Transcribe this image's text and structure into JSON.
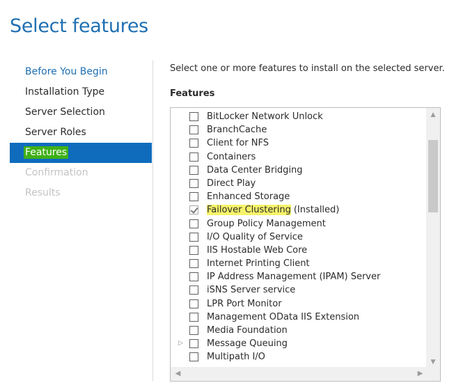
{
  "page": {
    "title": "Select features"
  },
  "nav": {
    "items": [
      {
        "label": "Before You Begin",
        "state": "link"
      },
      {
        "label": "Installation Type",
        "state": "normal"
      },
      {
        "label": "Server Selection",
        "state": "normal"
      },
      {
        "label": "Server Roles",
        "state": "normal"
      },
      {
        "label": "Features",
        "state": "selected"
      },
      {
        "label": "Confirmation",
        "state": "disabled"
      },
      {
        "label": "Results",
        "state": "disabled"
      }
    ]
  },
  "main": {
    "instruction": "Select one or more features to install on the selected server.",
    "features_heading": "Features",
    "features": [
      {
        "label": "BitLocker Network Unlock",
        "checked": false
      },
      {
        "label": "BranchCache",
        "checked": false
      },
      {
        "label": "Client for NFS",
        "checked": false
      },
      {
        "label": "Containers",
        "checked": false
      },
      {
        "label": "Data Center Bridging",
        "checked": false
      },
      {
        "label": "Direct Play",
        "checked": false
      },
      {
        "label": "Enhanced Storage",
        "checked": false
      },
      {
        "label": "Failover Clustering",
        "suffix": "(Installed)",
        "checked": true,
        "installed": true,
        "highlighted": true
      },
      {
        "label": "Group Policy Management",
        "checked": false
      },
      {
        "label": "I/O Quality of Service",
        "checked": false
      },
      {
        "label": "IIS Hostable Web Core",
        "checked": false
      },
      {
        "label": "Internet Printing Client",
        "checked": false
      },
      {
        "label": "IP Address Management (IPAM) Server",
        "checked": false
      },
      {
        "label": "iSNS Server service",
        "checked": false
      },
      {
        "label": "LPR Port Monitor",
        "checked": false
      },
      {
        "label": "Management OData IIS Extension",
        "checked": false
      },
      {
        "label": "Media Foundation",
        "checked": false
      },
      {
        "label": "Message Queuing",
        "checked": false,
        "expandable": true
      },
      {
        "label": "Multipath I/O",
        "checked": false
      }
    ]
  },
  "icons": {
    "up": "▲",
    "down": "▼",
    "left": "◀",
    "right": "▶",
    "expand": "▷"
  },
  "colors": {
    "accent": "#0f6cbd",
    "title": "#1f6fb2",
    "nav_highlight": "#3fb017",
    "feature_highlight": "#f6f36a"
  }
}
